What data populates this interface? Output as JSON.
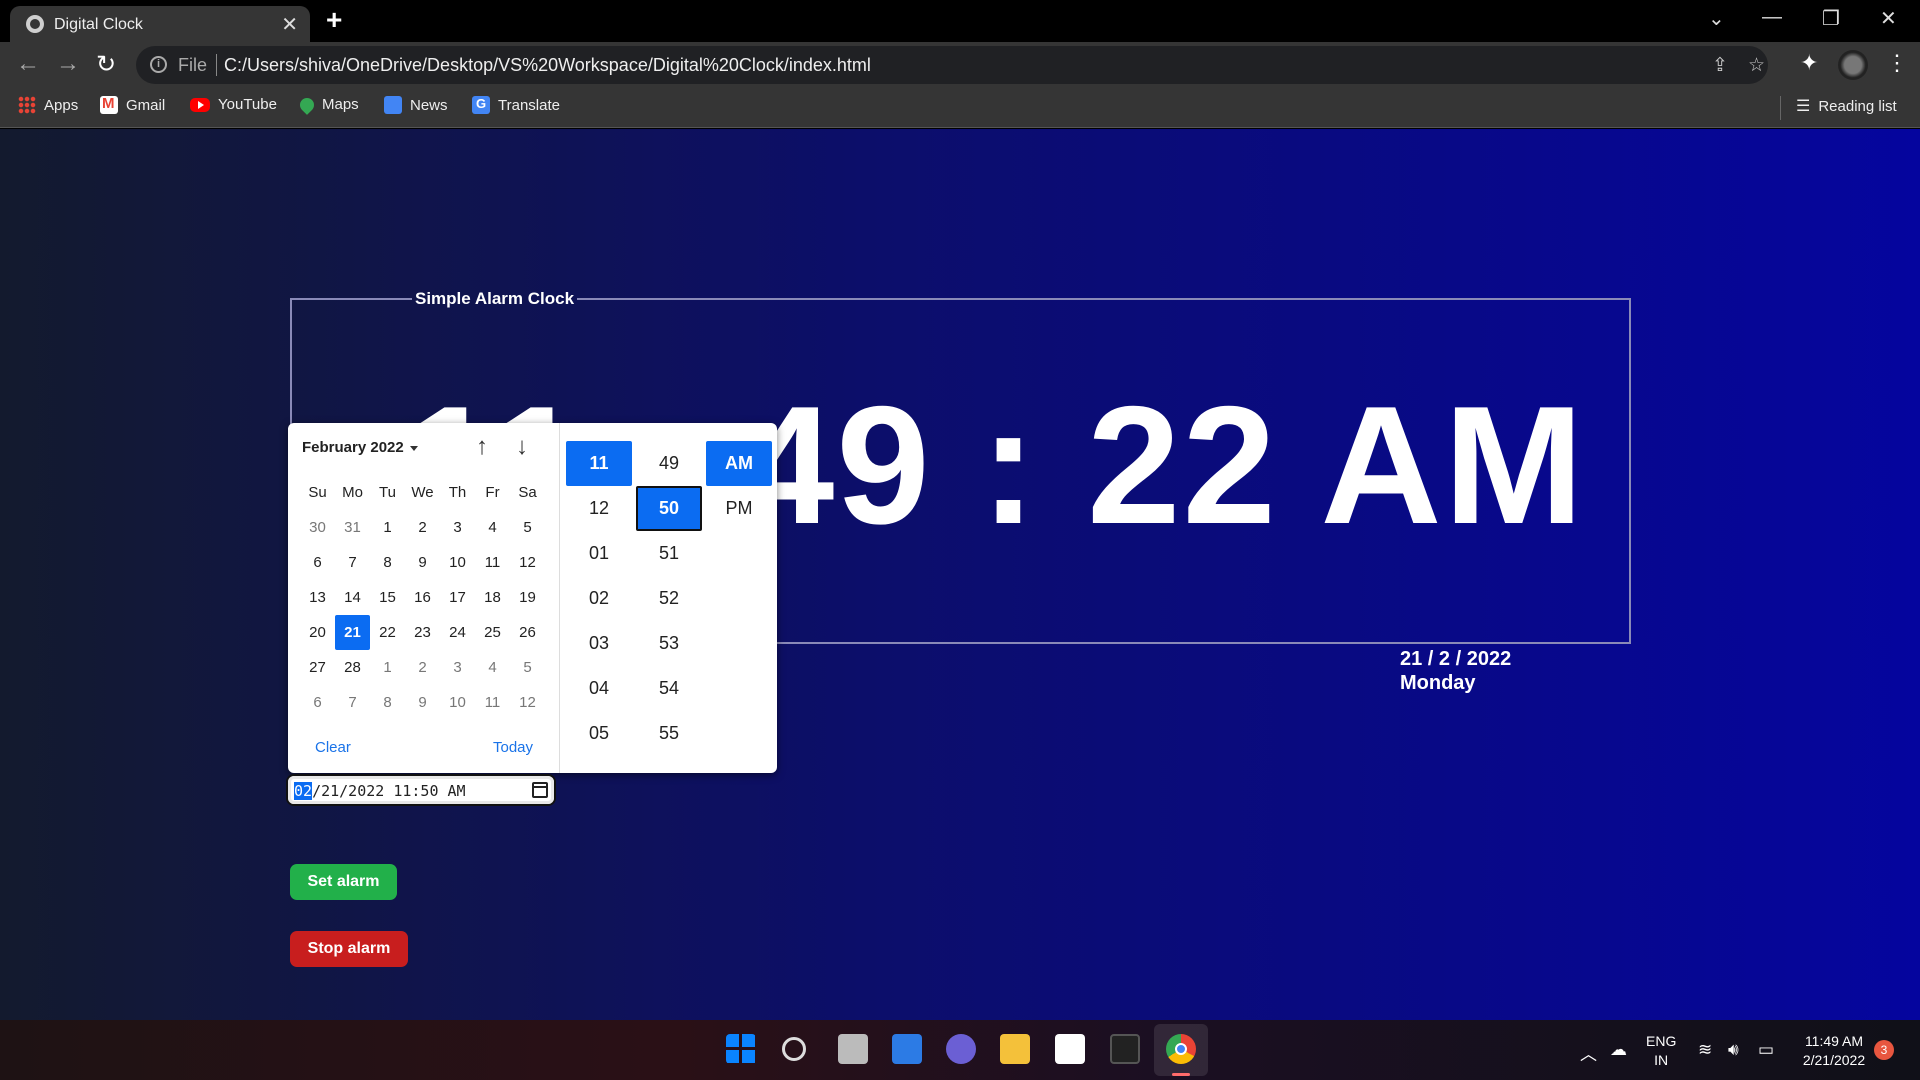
{
  "browser": {
    "tab_title": "Digital Clock",
    "url_scheme": "File",
    "url": "C:/Users/shiva/OneDrive/Desktop/VS%20Workspace/Digital%20Clock/index.html",
    "bookmarks": [
      "Apps",
      "Gmail",
      "YouTube",
      "Maps",
      "News",
      "Translate"
    ],
    "reading_list": "Reading list"
  },
  "clock": {
    "legend": "Simple Alarm Clock",
    "time_display": "11 : 49 : 22 AM",
    "date_line": "21 / 2 / 2022",
    "day_line": "Monday"
  },
  "picker": {
    "month_label": "February 2022",
    "weekdays": [
      "Su",
      "Mo",
      "Tu",
      "We",
      "Th",
      "Fr",
      "Sa"
    ],
    "weeks": [
      [
        "30",
        "31",
        "1",
        "2",
        "3",
        "4",
        "5"
      ],
      [
        "6",
        "7",
        "8",
        "9",
        "10",
        "11",
        "12"
      ],
      [
        "13",
        "14",
        "15",
        "16",
        "17",
        "18",
        "19"
      ],
      [
        "20",
        "21",
        "22",
        "23",
        "24",
        "25",
        "26"
      ],
      [
        "27",
        "28",
        "1",
        "2",
        "3",
        "4",
        "5"
      ],
      [
        "6",
        "7",
        "8",
        "9",
        "10",
        "11",
        "12"
      ]
    ],
    "selected_day": "21",
    "clear_label": "Clear",
    "today_label": "Today",
    "hours": [
      "11",
      "12",
      "01",
      "02",
      "03",
      "04",
      "05"
    ],
    "minutes": [
      "49",
      "50",
      "51",
      "52",
      "53",
      "54",
      "55"
    ],
    "meridiem": [
      "AM",
      "PM"
    ],
    "selected_hour": "11",
    "selected_minute": "50",
    "selected_meridiem": "AM"
  },
  "alarm_input": {
    "month_segment": "02",
    "rest_value": "/21/2022 11:50 AM"
  },
  "buttons": {
    "set_alarm": "Set alarm",
    "stop_alarm": "Stop alarm"
  },
  "taskbar": {
    "lang_top": "ENG",
    "lang_bottom": "IN",
    "time": "11:49 AM",
    "date": "2/21/2022",
    "notifications": "3"
  },
  "colors": {
    "accent": "#0b6cf2",
    "set_alarm_bg": "#22b04a",
    "stop_alarm_bg": "#c81e1e"
  }
}
